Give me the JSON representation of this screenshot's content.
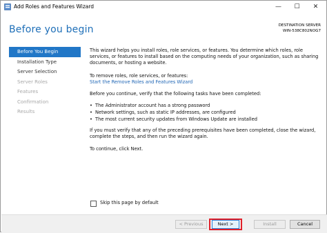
{
  "window": {
    "title": "Add Roles and Features Wizard",
    "controls": {
      "minimize": "—",
      "maximize": "☐",
      "close": "✕"
    }
  },
  "header": {
    "page_title": "Before you begin",
    "destination_label": "DESTINATION SERVER",
    "destination_server": "WIN-538C802NOG7"
  },
  "nav": {
    "items": [
      {
        "label": "Before You Begin",
        "state": "active"
      },
      {
        "label": "Installation Type",
        "state": "enabled"
      },
      {
        "label": "Server Selection",
        "state": "enabled"
      },
      {
        "label": "Server Roles",
        "state": "disabled"
      },
      {
        "label": "Features",
        "state": "disabled"
      },
      {
        "label": "Confirmation",
        "state": "disabled"
      },
      {
        "label": "Results",
        "state": "disabled"
      }
    ]
  },
  "content": {
    "intro": "This wizard helps you install roles, role services, or features. You determine which roles, role services, or features to install based on the computing needs of your organization, such as sharing documents, or hosting a website.",
    "remove_intro": "To remove roles, role services, or features:",
    "remove_link": "Start the Remove Roles and Features Wizard",
    "before_continue": "Before you continue, verify that the following tasks have been completed:",
    "bullets": [
      "The Administrator account has a strong password",
      "Network settings, such as static IP addresses, are configured",
      "The most current security updates from Windows Update are installed"
    ],
    "verify_text": "If you must verify that any of the preceding prerequisites have been completed, close the wizard, complete the steps, and then run the wizard again.",
    "continue_text": "To continue, click Next."
  },
  "skip": {
    "label": "Skip this page by default",
    "checked": false
  },
  "footer": {
    "previous_label": "< Previous",
    "next_label": "Next >",
    "install_label": "Install",
    "cancel_label": "Cancel"
  },
  "colors": {
    "accent": "#2177c7",
    "title_blue": "#1e6fb8",
    "highlight_red": "#e0202a"
  }
}
